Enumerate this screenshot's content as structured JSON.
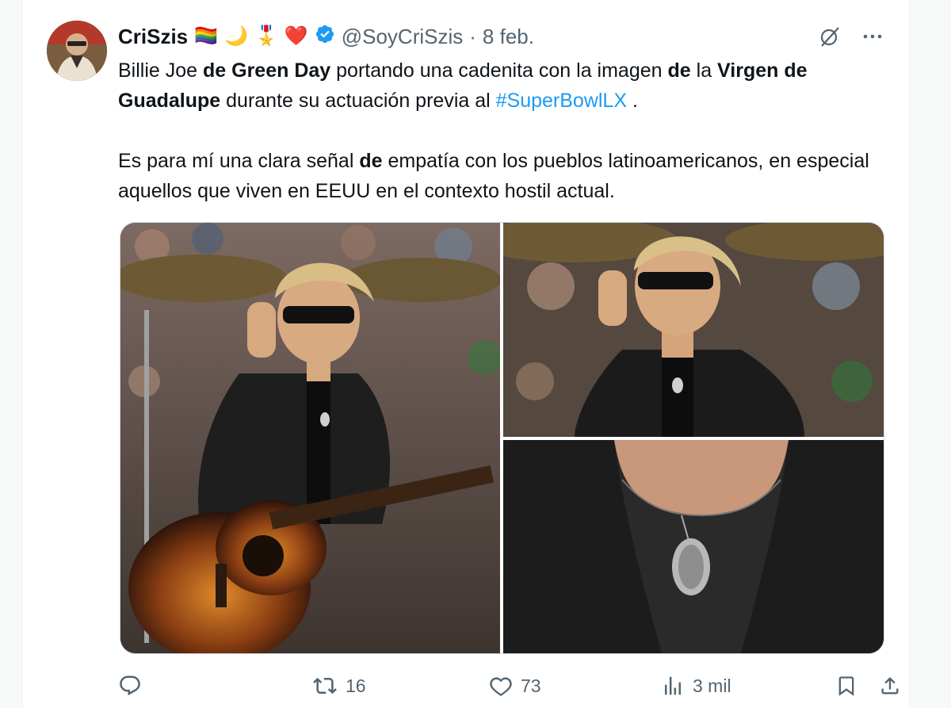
{
  "tweet": {
    "display_name": "CriSzis",
    "name_emojis": [
      "🏳️‍🌈",
      "🌙",
      "🎖️",
      "❤️"
    ],
    "handle": "@SoyCriSzis",
    "separator": "·",
    "date": "8 feb.",
    "body": {
      "p1_segments": [
        {
          "text": "Billie Joe ",
          "style": "normal"
        },
        {
          "text": "de Green Day",
          "style": "bold"
        },
        {
          "text": " portando una cadenita con la imagen ",
          "style": "normal"
        },
        {
          "text": "de",
          "style": "bold"
        },
        {
          "text": " la ",
          "style": "normal"
        },
        {
          "text": "Virgen de Guadalupe",
          "style": "bold"
        },
        {
          "text": " durante su actuación previa al ",
          "style": "normal"
        },
        {
          "text": "#SuperBowlLX",
          "style": "hashtag"
        },
        {
          "text": " .",
          "style": "normal"
        }
      ],
      "p2_segments": [
        {
          "text": "Es para mí una clara señal ",
          "style": "normal"
        },
        {
          "text": "de",
          "style": "bold"
        },
        {
          "text": " empatía con los pueblos latinoamericanos, en especial aquellos que viven en EEUU en el contexto hostil actual.",
          "style": "normal"
        }
      ]
    },
    "stats": {
      "retweets": "16",
      "likes": "73",
      "views": "3 mil"
    }
  },
  "icons": {
    "verified": "verified-badge-icon",
    "grok": "grok-icon",
    "more": "more-icon",
    "reply": "reply-icon",
    "retweet": "retweet-icon",
    "like": "like-icon",
    "views": "views-icon",
    "bookmark": "bookmark-icon",
    "share": "share-icon"
  },
  "colors": {
    "link": "#1d9bf0",
    "secondary_text": "#536471",
    "primary_text": "#0f1419"
  }
}
